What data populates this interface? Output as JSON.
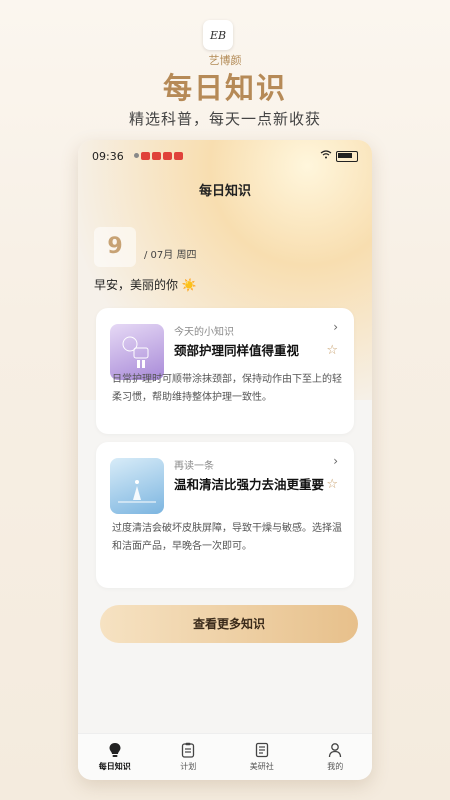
{
  "header": {
    "logo_text": "艺博颜",
    "brand": "艺博颜",
    "title": "每日知识",
    "subtitle": "精选科普，每天一点新收获"
  },
  "status_bar": {
    "time": "09:36"
  },
  "page": {
    "title": "每日知识",
    "day": "9",
    "date_rest": "/ 07月 周四",
    "greeting": "早安，美丽的你 ☀️"
  },
  "cards": [
    {
      "label": "今天的小知识",
      "title": "颈部护理同样值得重视",
      "body": "日常护理时可顺带涂抹颈部，保持动作由下至上的轻柔习惯，帮助维持整体护理一致性。"
    },
    {
      "label": "再读一条",
      "title": "温和清洁比强力去油更重要",
      "body": "过度清洁会破坏皮肤屏障，导致干燥与敏感。选择温和洁面产品，早晚各一次即可。"
    }
  ],
  "cta_label": "查看更多知识",
  "tabs": [
    {
      "label": "每日知识",
      "icon": "bulb-icon"
    },
    {
      "label": "计划",
      "icon": "clipboard-icon"
    },
    {
      "label": "美研社",
      "icon": "document-icon"
    },
    {
      "label": "我的",
      "icon": "user-icon"
    }
  ],
  "colors": {
    "accent": "#b68a57",
    "cta_start": "#f6e2c2",
    "cta_end": "#e7c08b"
  }
}
